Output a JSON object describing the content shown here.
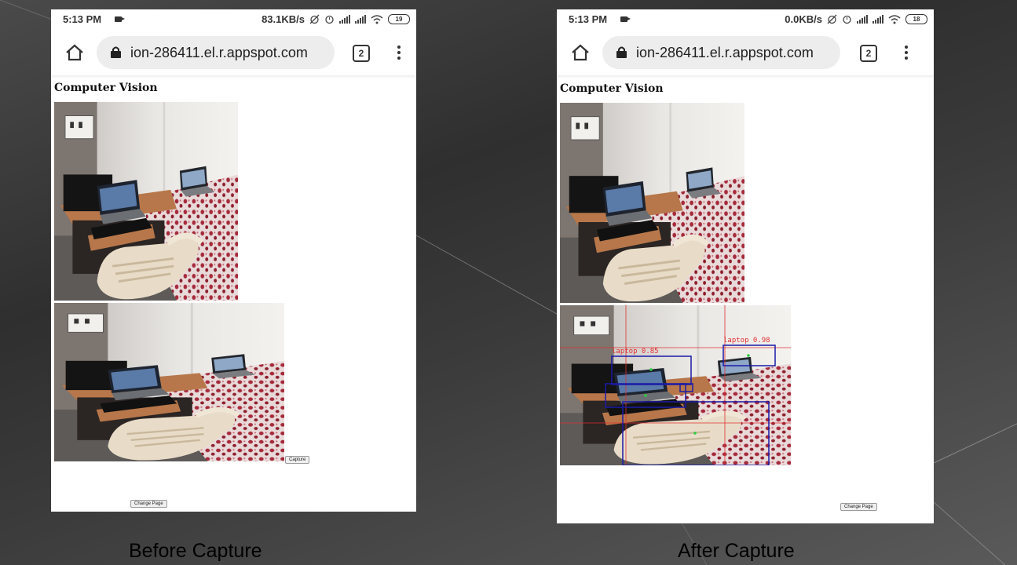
{
  "left_panel": {
    "status": {
      "time": "5:13 PM",
      "network_speed": "83.1KB/s",
      "battery": "19"
    },
    "browser": {
      "url": "ion-286411.el.r.appspot.com",
      "tab_count": "2"
    },
    "page": {
      "heading": "Computer Vision",
      "capture_label": "Capture",
      "change_page_label": "Change Page"
    },
    "caption": "Before Capture"
  },
  "right_panel": {
    "status": {
      "time": "5:13 PM",
      "network_speed": "0.0KB/s",
      "battery": "18"
    },
    "browser": {
      "url": "ion-286411.el.r.appspot.com",
      "tab_count": "2"
    },
    "page": {
      "heading": "Computer Vision",
      "change_page_label": "Change Page"
    },
    "detections": [
      {
        "label": "laptop 0.98"
      },
      {
        "label": "laptop 0.85"
      }
    ],
    "caption": "After Capture"
  },
  "icons": [
    "home-icon",
    "lock-icon",
    "tabs-count-icon",
    "overflow-menu-icon",
    "camera-icon",
    "alarm-icon",
    "wifi-icon",
    "signal-icon",
    "battery-icon"
  ],
  "colors": {
    "detection_box": "#1a1aa8",
    "detection_label": "#e03030",
    "center_point": "#2ecc40"
  }
}
